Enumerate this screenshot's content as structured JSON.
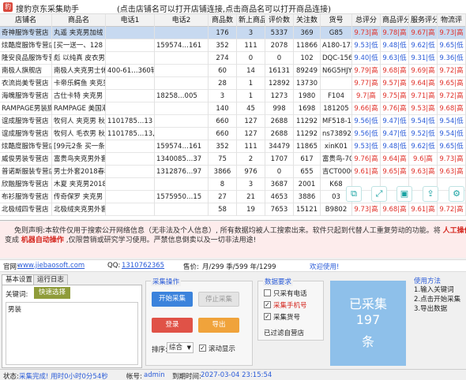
{
  "app": {
    "title": "搜豹京东采集助手",
    "hint": "(点击店铺名可以打开店铺连接,点击商品名可以打开商品连接)"
  },
  "table": {
    "columns": [
      "店铺名",
      "商品名",
      "电话1",
      "电话2",
      "商品数",
      "新上商品",
      "评价数",
      "关注数",
      "货号",
      "总评分",
      "商品评分",
      "服务评分",
      "物流评"
    ],
    "rows": [
      {
        "shop": "奇神服饰专营店",
        "item": "丸遥 夹克男加绒",
        "tel1": "",
        "tel2": "",
        "qty": "176",
        "new": "3",
        "rev": "5337",
        "fol": "369",
        "sku": "G85",
        "s1": "9.73|高",
        "s2": "9.78|高",
        "s3": "9.67|高",
        "s4": "9.73|高"
      },
      {
        "shop": "炫酷度服饰专营店",
        "item": "[买一送一、128",
        "tel1": "",
        "tel2": "159574…161",
        "qty": "352",
        "new": "111",
        "rev": "2078",
        "fol": "11866",
        "sku": "A180-173",
        "s1": "9.53|低",
        "s2": "9.48|低",
        "s3": "9.62|低",
        "s4": "9.65|低"
      },
      {
        "shop": "隆安良品服饰专营店",
        "item": "彪 以纯真 皮衣男",
        "tel1": "",
        "tel2": "",
        "qty": "274",
        "new": "0",
        "rev": "0",
        "fol": "102",
        "sku": "DQC-1560",
        "s1": "9.40|低",
        "s2": "9.63|低",
        "s3": "9.31|低",
        "s4": "9.36|低"
      },
      {
        "shop": "南极人旗舰店",
        "item": "南极人夹克男士休",
        "tel1": "400-61…360转",
        "tel2": "",
        "qty": "60",
        "new": "14",
        "rev": "16131",
        "fol": "89249",
        "sku": "N6G5HJY",
        "s1": "9.79|高",
        "s2": "9.68|高",
        "s3": "9.69|高",
        "s4": "9.72|高"
      },
      {
        "shop": "衣流尚美专营店",
        "item": "卡帝乐鳄鱼 夹克男",
        "tel1": "",
        "tel2": "",
        "qty": "28",
        "new": "1",
        "rev": "12892",
        "fol": "13730",
        "sku": "",
        "s1": "9.77|高",
        "s2": "9.57|高",
        "s3": "9.64|高",
        "s4": "9.65|高"
      },
      {
        "shop": "海魄服饰专营店",
        "item": "古仕卡特 夹克男",
        "tel1": "",
        "tel2": "18258…005",
        "qty": "3",
        "new": "1",
        "rev": "1273",
        "fol": "1980",
        "sku": "F104",
        "s1": "9.7|高",
        "s2": "9.75|高",
        "s3": "9.71|高",
        "s4": "9.72|高"
      },
      {
        "shop": "RAMPAGE男装旗",
        "item": "RAMPAGE 美国潮",
        "tel1": "",
        "tel2": "",
        "qty": "140",
        "new": "45",
        "rev": "998",
        "fol": "1698",
        "sku": "181205",
        "s1": "9.66|高",
        "s2": "9.76|高",
        "s3": "9.53|高",
        "s4": "9.68|高"
      },
      {
        "shop": "谊成服饰专营店",
        "item": "牧何人 夹克男 秋",
        "tel1": "1101785…13",
        "tel2": "",
        "qty": "660",
        "new": "127",
        "rev": "2688",
        "fol": "11292",
        "sku": "MF518-19",
        "s1": "9.56|低",
        "s2": "9.47|低",
        "s3": "9.54|低",
        "s4": "9.54|低"
      },
      {
        "shop": "谊成服饰专营店",
        "item": "牧何人 毛衣男 秋冬",
        "tel1": "1101785…13, 13",
        "tel2": "",
        "qty": "660",
        "new": "127",
        "rev": "2688",
        "fol": "11292",
        "sku": "ns738921",
        "s1": "9.56|低",
        "s2": "9.47|低",
        "s3": "9.52|低",
        "s4": "9.54|低"
      },
      {
        "shop": "炫酷度服饰专营店",
        "item": "[99元2条 买一条",
        "tel1": "",
        "tel2": "159574…161",
        "qty": "352",
        "new": "111",
        "rev": "34479",
        "fol": "11865",
        "sku": "xinK01",
        "s1": "9.53|低",
        "s2": "9.48|低",
        "s3": "9.62|低",
        "s4": "9.65|低"
      },
      {
        "shop": "威俊男装专营店",
        "item": "富贵鸟夹克男外套",
        "tel1": "",
        "tel2": "1340085…37",
        "qty": "75",
        "new": "2",
        "rev": "1707",
        "fol": "617",
        "sku": "富贵鸟-70",
        "s1": "9.76|高",
        "s2": "9.64|高",
        "s3": "9.6|高",
        "s4": "9.73|高"
      },
      {
        "shop": "普诺斯服装专营店",
        "item": "男士外套2018春秋",
        "tel1": "",
        "tel2": "1312876…97",
        "qty": "3866",
        "new": "976",
        "rev": "0",
        "fol": "655",
        "sku": "吉CT0000",
        "s1": "9.61|高",
        "s2": "9.65|高",
        "s3": "9.63|高",
        "s4": "9.63|高"
      },
      {
        "shop": "欣融服饰专营店",
        "item": "木夏 夹克男2018",
        "tel1": "",
        "tel2": "",
        "qty": "8",
        "new": "3",
        "rev": "3687",
        "fol": "2001",
        "sku": "K68",
        "s1": "",
        "s2": "",
        "s3": "",
        "s4": ""
      },
      {
        "shop": "布衫服饰专营店",
        "item": "传奇保罗 夹克男",
        "tel1": "",
        "tel2": "1575950…15",
        "qty": "27",
        "new": "21",
        "rev": "4653",
        "fol": "3886",
        "sku": "03",
        "s1": "",
        "s2": "",
        "s3": "",
        "s4": ""
      },
      {
        "shop": "北极绒四专营店",
        "item": "北极绒夹克男外套",
        "tel1": "",
        "tel2": "",
        "qty": "58",
        "new": "19",
        "rev": "7653",
        "fol": "15121",
        "sku": "B9802",
        "s1": "9.73|高",
        "s2": "9.68|高",
        "s3": "9.61|高",
        "s4": "9.72|高"
      }
    ]
  },
  "float_icons": [
    "copy-icon",
    "expand-icon",
    "save-icon",
    "share-icon",
    "settings-icon"
  ],
  "disclaimer": {
    "line1_prefix": "免则声明:本软件仅用于搜索公开网络信息（无非法及个人信息）, 所有数据均被人工搜索出来。软件只起到代替人工重复劳动的功能。将",
    "line1_strong": "人工操作",
    "line2_prefix": "变成",
    "line2_strong": "机器自动操作",
    "line2_suffix": ",仅限营销或研究学习使用。严禁信息倒卖以及一切非法用途!"
  },
  "info": {
    "site_label": "官网:",
    "site": "www.jiebaosoft.com",
    "qq_label": "QQ:",
    "qq": "1310762365",
    "price_label": "售价:",
    "price": "月/299 季/599 年/1299",
    "welcome": "欢迎使用!"
  },
  "tabs": [
    "基本设置",
    "运行日志"
  ],
  "keywords": {
    "label": "关键词:",
    "quick_btn": "快速选择",
    "value": "男装"
  },
  "collect": {
    "title": "采集操作",
    "start": "开始采集",
    "stop": "停止采集",
    "login": "登录",
    "export": "导出",
    "sort_label": "排序:",
    "sort_value": "综合",
    "auto_scroll": "滚动显示"
  },
  "data_req": {
    "title": "数据要求",
    "opt1": "只采有电话",
    "opt2": "采集手机号",
    "opt3": "采集货号",
    "note": "已过滤自营店"
  },
  "collected": {
    "l1": "已采集",
    "l2": "197",
    "l3": "条"
  },
  "usage": {
    "title": "使用方法",
    "items": [
      "1.输入关键词",
      "2.点击开始采集",
      "3.导出数据"
    ]
  },
  "status": {
    "label": "状态:",
    "value": "采集完成! 用时0小时0分54秒",
    "acct_label": "帐号:",
    "acct": "admin",
    "expire_label": "到期时间:",
    "expire": "2027-03-04 23:15:54"
  },
  "colors": {
    "high": "#e0312a",
    "low": "#2a5bd8",
    "collected_bg": "#8ec0ea"
  }
}
